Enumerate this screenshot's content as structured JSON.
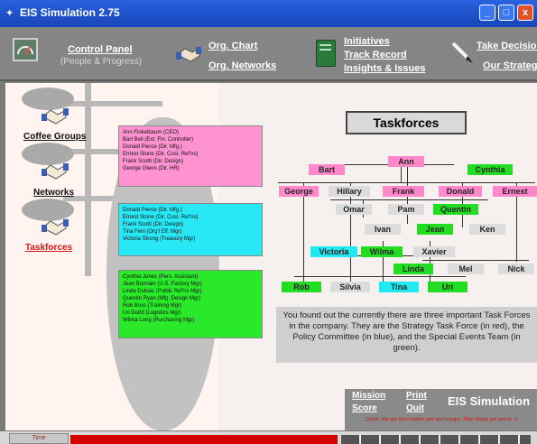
{
  "window": {
    "title": "EIS Simulation 2.75",
    "min": "_",
    "max": "□",
    "close": "x"
  },
  "toolbar": {
    "control_panel": "Control Panel",
    "control_panel_sub": "(People & Progress)",
    "org_chart": "Org. Chart",
    "org_networks": "Org. Networks",
    "initiatives": "Initiatives",
    "track_record": "Track Record",
    "insights": "Insights & Issues",
    "take_decision": "Take Decision",
    "our_strategy": "Our Strategy"
  },
  "nav": {
    "coffee": "Coffee Groups",
    "networks": "Networks",
    "taskforces": "Taskforces"
  },
  "groups": {
    "pink": [
      "Ann Finkelbaum (CEO)",
      "Bart Bell (Ext. Fin. Controller)",
      "Donald Pierce (Dir. Mfg.)",
      "Ernest Stone (Dir. Cust. Ref'ns)",
      "Frank Scotti (Dir. Design)",
      "George Glenn (Dir. HR)"
    ],
    "cyan": [
      "Donald Pierce (Dir. Mfg.)",
      "Ernest Stone (Dir. Cust. Ref'ns)",
      "Frank Scotti (Dir. Design)",
      "Tina Fein (Org'l Eff. Mgr)",
      "Victoria Strong (Treasury Mgr)"
    ],
    "green": [
      "Cynthia Jones (Pers. Assistant)",
      "Jean Bonnain (U.S. Factory Mgr)",
      "Linda Duboiz (Public Ref'ns Mgr)",
      "Quentin Ryan (Mfg. Design Mgr)",
      "Rob Boss (Training Mgr)",
      "Uri Dodd (Logistics Mgr)",
      "Wilma Long (Purchasing Mgr)"
    ]
  },
  "diagram": {
    "title": "Taskforces",
    "nodes": {
      "ann": "Ann",
      "bart": "Bart",
      "cynthia": "Cynthia",
      "george": "George",
      "hillary": "Hillary",
      "frank": "Frank",
      "donald": "Donald",
      "ernest": "Ernest",
      "omar": "Omar",
      "pam": "Pam",
      "quentin": "Quentin",
      "ivan": "Ivan",
      "jean": "Jean",
      "ken": "Ken",
      "victoria": "Victoria",
      "wilma": "Wilma",
      "xavier": "Xavier",
      "linda": "Linda",
      "mel": "Mel",
      "nick": "Nick",
      "rob": "Rob",
      "silvia": "Silvia",
      "tina": "Tina",
      "uri": "Uri"
    }
  },
  "message": "You found out the currently there are three important Task Forces in the company. They are the Strategy Task Force (in red), the Policy Committee (in blue), and the Special Events Team (in green).",
  "footer": {
    "mission": "Mission",
    "score": "Score",
    "print": "Print",
    "quit": "Quit",
    "brand": "EIS Simulation",
    "quote": "Quote: We are born naked, wet and hungry. Then things get worse :-)"
  },
  "status": {
    "time_label": "Time"
  }
}
